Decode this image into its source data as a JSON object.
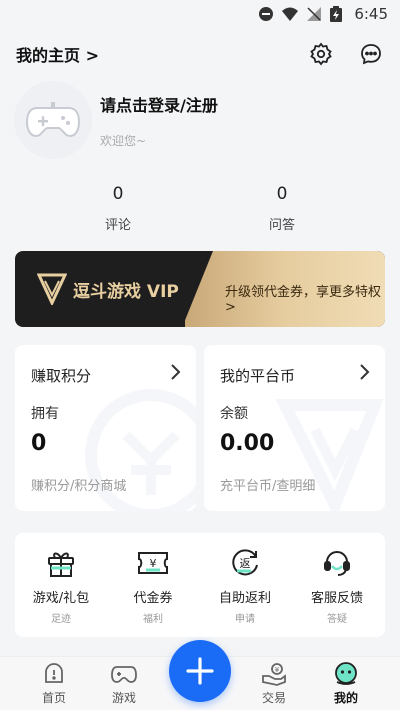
{
  "status_bar": {
    "time": "6:45"
  },
  "header": {
    "title": "我的主页 >"
  },
  "profile": {
    "login_text": "请点击登录/注册",
    "welcome_text": "欢迎您~"
  },
  "stats": [
    {
      "value": "0",
      "label": "评论"
    },
    {
      "value": "0",
      "label": "问答"
    }
  ],
  "vip": {
    "name": "逗斗游戏 VIP",
    "action": "升级领代金券，享更多特权>",
    "logo_text": "VIP"
  },
  "cards": {
    "points": {
      "title": "赚取积分",
      "label": "拥有",
      "value": "0",
      "sub": "赚积分/积分商城"
    },
    "coins": {
      "title": "我的平台币",
      "label": "余额",
      "value": "0.00",
      "sub": "充平台币/查明细"
    }
  },
  "tools": [
    {
      "name": "游戏/礼包",
      "sub": "足迹",
      "icon": "gift-icon"
    },
    {
      "name": "代金券",
      "sub": "福利",
      "icon": "voucher-icon"
    },
    {
      "name": "自助返利",
      "sub": "申请",
      "icon": "rebate-icon",
      "badge": "返"
    },
    {
      "name": "客服反馈",
      "sub": "答疑",
      "icon": "customer-service-icon"
    }
  ],
  "tabbar": {
    "items": [
      {
        "label": "首页",
        "icon": "home-icon"
      },
      {
        "label": "游戏",
        "icon": "gamepad-icon"
      },
      {
        "label": "交易",
        "icon": "trade-icon"
      },
      {
        "label": "我的",
        "icon": "me-icon"
      }
    ],
    "active": "我的",
    "fab_icon": "plus-icon"
  },
  "colors": {
    "accent": "#1a6bf5",
    "vip_dark": "#1f1e1f",
    "vip_gold": "#e6cda0",
    "mint": "#6fe3c6"
  }
}
